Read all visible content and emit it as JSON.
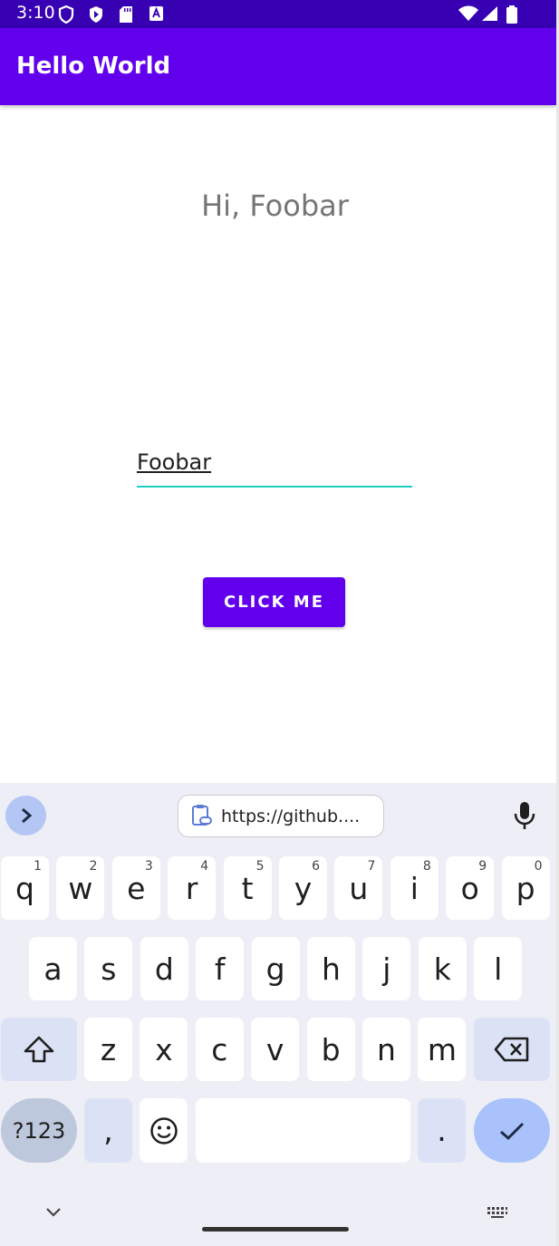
{
  "status_bar": {
    "time": "3:10"
  },
  "app_bar": {
    "title": "Hello World"
  },
  "greeting": "Hi, Foobar",
  "name_input": {
    "value": "Foobar"
  },
  "click_button": {
    "label": "CLICK ME"
  },
  "keyboard": {
    "clipboard_text": "https://github....",
    "row1": [
      {
        "k": "q",
        "h": "1"
      },
      {
        "k": "w",
        "h": "2"
      },
      {
        "k": "e",
        "h": "3"
      },
      {
        "k": "r",
        "h": "4"
      },
      {
        "k": "t",
        "h": "5"
      },
      {
        "k": "y",
        "h": "6"
      },
      {
        "k": "u",
        "h": "7"
      },
      {
        "k": "i",
        "h": "8"
      },
      {
        "k": "o",
        "h": "9"
      },
      {
        "k": "p",
        "h": "0"
      }
    ],
    "row2": [
      "a",
      "s",
      "d",
      "f",
      "g",
      "h",
      "j",
      "k",
      "l"
    ],
    "row3": [
      "z",
      "x",
      "c",
      "v",
      "b",
      "n",
      "m"
    ],
    "symbols_label": "?123",
    "comma_label": ",",
    "period_label": "."
  }
}
